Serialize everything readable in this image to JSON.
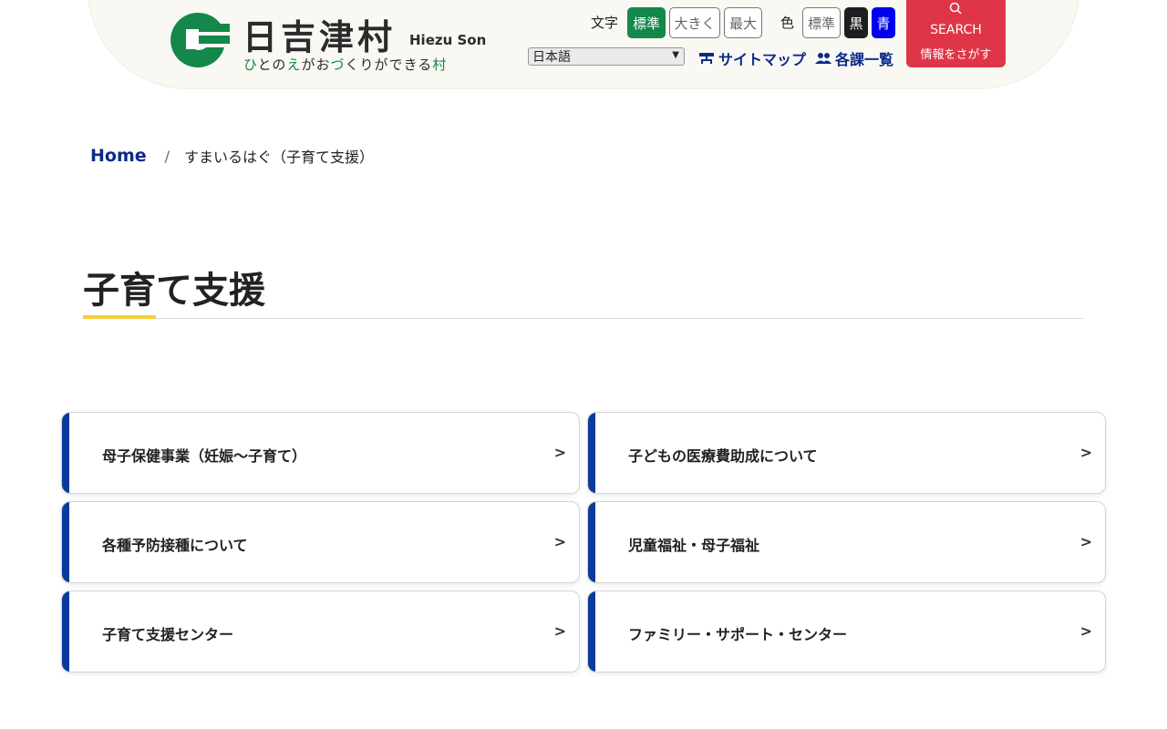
{
  "header": {
    "logo_name": "日吉津村",
    "logo_roman": "Hiezu Son",
    "tagline": [
      "ひ",
      "と",
      "の",
      "え",
      "が",
      "お",
      "づ",
      "く",
      "り",
      "が",
      "で",
      "き",
      "る",
      "村"
    ],
    "text_size_label": "文字",
    "text_size_buttons": [
      "標準",
      "大きく",
      "最大"
    ],
    "color_label": "色",
    "color_buttons": [
      "標準",
      "黒",
      "青"
    ],
    "language_select": "日本語",
    "sitemap_label": "サイトマップ",
    "departments_label": "各課一覧",
    "search_label": "SEARCH",
    "search_sub": "情報をさがす"
  },
  "breadcrumb": {
    "home": "Home",
    "separator": "/",
    "current": "すまいるはぐ（子育て支援）"
  },
  "page_title": "子育て支援",
  "cards": [
    {
      "label": "母子保健事業（妊娠～子育て）"
    },
    {
      "label": "子どもの医療費助成について"
    },
    {
      "label": "各種予防接種について"
    },
    {
      "label": "児童福祉・母子福祉"
    },
    {
      "label": "子育て支援センター"
    },
    {
      "label": "ファミリー・サポート・センター"
    }
  ],
  "colors": {
    "brand_green": "#13884a",
    "nav_blue": "#0b2a8a",
    "search_red": "#df3548",
    "card_bar": "#0a3b9c",
    "title_accent": "#f5cd3b"
  }
}
